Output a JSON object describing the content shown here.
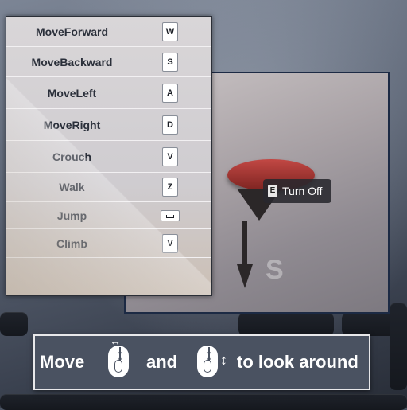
{
  "controls": [
    {
      "action": "MoveForward",
      "key": "W"
    },
    {
      "action": "MoveBackward",
      "key": "S"
    },
    {
      "action": "MoveLeft",
      "key": "A"
    },
    {
      "action": "MoveRight",
      "key": "D"
    },
    {
      "action": "Crouch",
      "key": "V"
    },
    {
      "action": "Walk",
      "key": "Z"
    },
    {
      "action": "Jump",
      "key": "space"
    },
    {
      "action": "Climb",
      "key": "V"
    }
  ],
  "prompt": {
    "key": "E",
    "text": "Turn Off"
  },
  "look_banner": {
    "move": "Move",
    "and": "and",
    "look_around": "to look around",
    "mouse_move_icon": "mouse-horizontal-icon",
    "mouse_look_icon": "mouse-vertical-icon"
  },
  "colors": {
    "panel_bg": "#d6d3d6",
    "banner_bg": "#4a5261",
    "text_dark": "#2a2f3a",
    "dome_red": "#c24844"
  }
}
